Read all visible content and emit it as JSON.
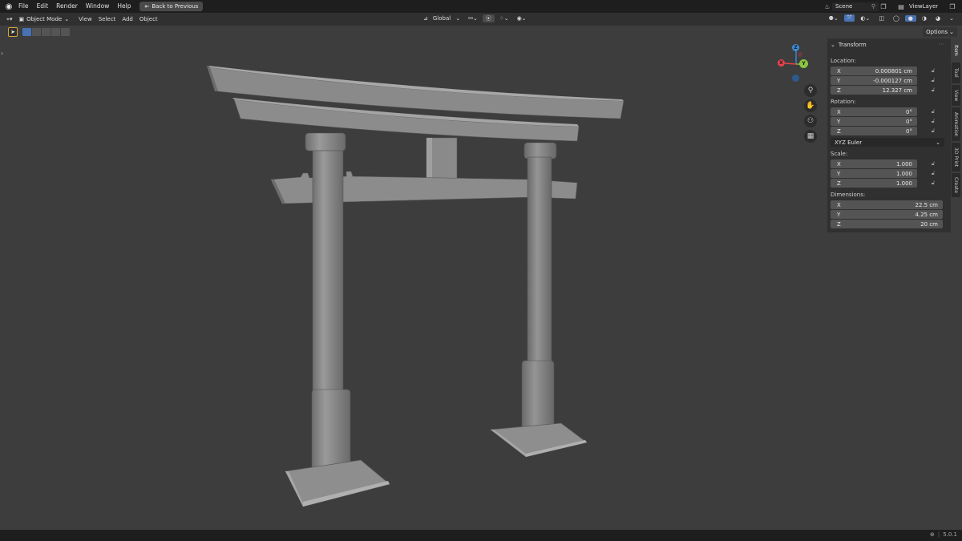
{
  "topbar": {
    "menus": [
      "File",
      "Edit",
      "Render",
      "Window",
      "Help"
    ],
    "back_button": "Back to Previous",
    "scene": "Scene",
    "view_layer": "ViewLayer"
  },
  "header": {
    "mode": "Object Mode",
    "menus": [
      "View",
      "Select",
      "Add",
      "Object"
    ],
    "orientation": "Global"
  },
  "toolrow": {
    "options": "Options"
  },
  "gizmo": {
    "z": "Z",
    "y": "Y",
    "x": "X"
  },
  "npanel": {
    "title": "Transform",
    "location_label": "Location:",
    "location": [
      {
        "axis": "X",
        "value": "0.000801 cm"
      },
      {
        "axis": "Y",
        "value": "-0.000127 cm"
      },
      {
        "axis": "Z",
        "value": "12.327 cm"
      }
    ],
    "rotation_label": "Rotation:",
    "rotation": [
      {
        "axis": "X",
        "value": "0°"
      },
      {
        "axis": "Y",
        "value": "0°"
      },
      {
        "axis": "Z",
        "value": "0°"
      }
    ],
    "rotation_mode": "XYZ Euler",
    "scale_label": "Scale:",
    "scale": [
      {
        "axis": "X",
        "value": "1.000"
      },
      {
        "axis": "Y",
        "value": "1.000"
      },
      {
        "axis": "Z",
        "value": "1.000"
      }
    ],
    "dimensions_label": "Dimensions:",
    "dimensions": [
      {
        "axis": "X",
        "value": "22.5 cm"
      },
      {
        "axis": "Y",
        "value": "4.25 cm"
      },
      {
        "axis": "Z",
        "value": "20 cm"
      }
    ]
  },
  "tabs": [
    "Item",
    "Tool",
    "View",
    "Animation",
    "3D Print",
    "Create"
  ],
  "status": {
    "version": "5.0.1"
  },
  "colors": {
    "accent_active_tool": "#d9a53a",
    "selection_blue": "#4772b3",
    "axis_x": "#e8424f",
    "axis_y": "#8bc43f",
    "axis_z": "#3b8bd8"
  }
}
